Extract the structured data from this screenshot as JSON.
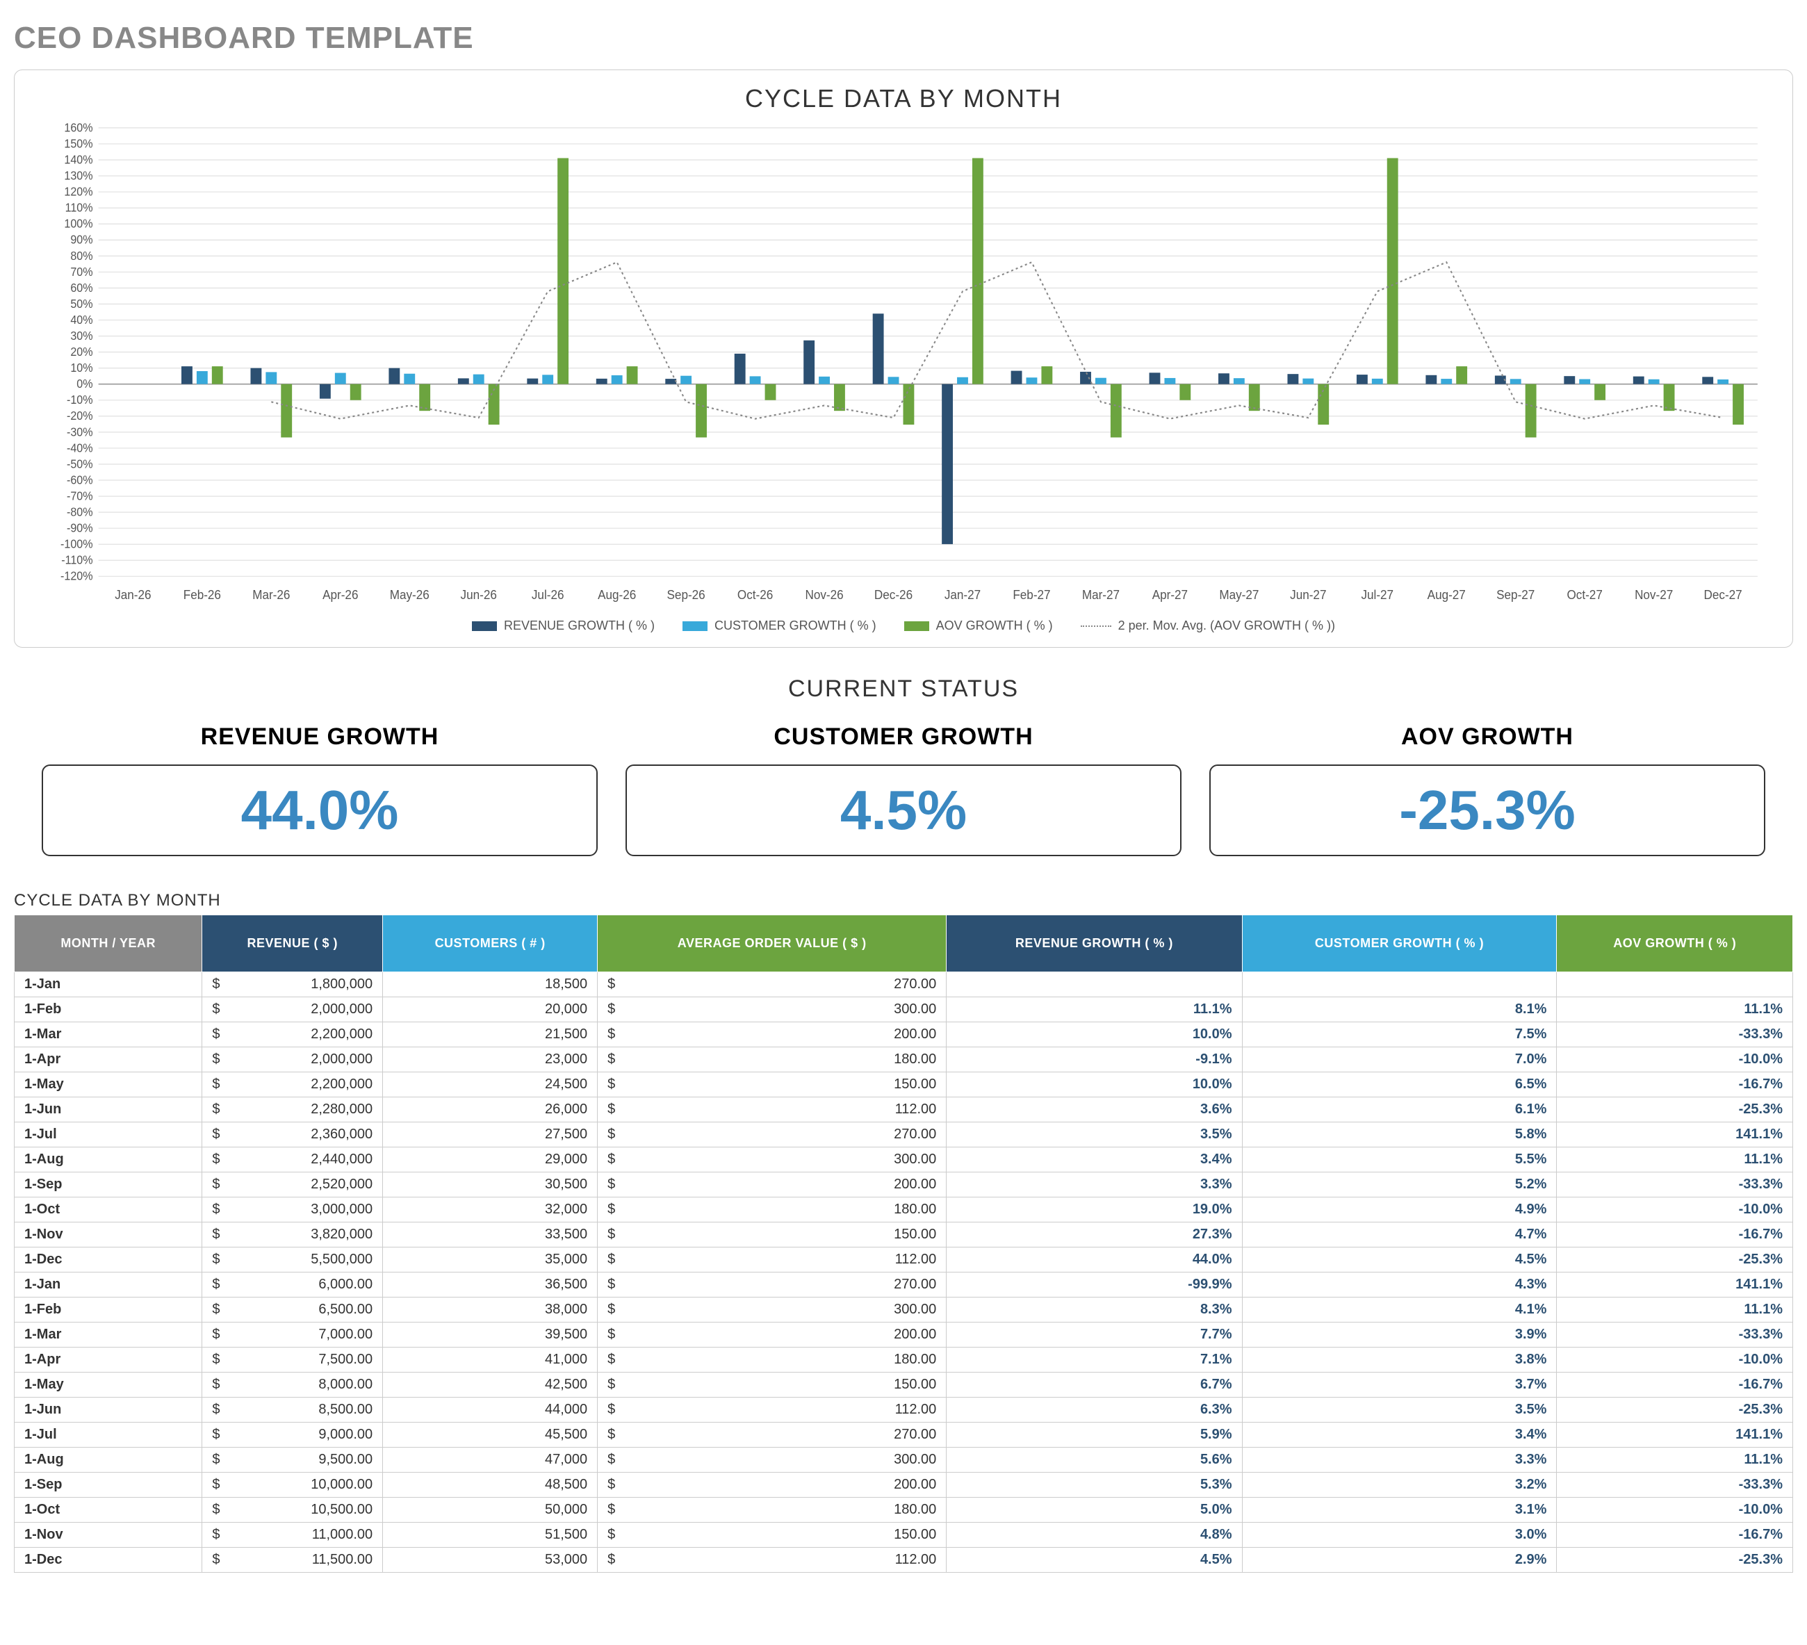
{
  "title": "CEO DASHBOARD TEMPLATE",
  "chart_title": "CYCLE DATA BY MONTH",
  "section_status": "CURRENT STATUS",
  "table_caption": "CYCLE DATA BY MONTH",
  "colors": {
    "revenue": "#2C5072",
    "customer": "#38A9DA",
    "aov": "#6CA43F",
    "mov_avg": "#888888"
  },
  "status": {
    "revenue": {
      "label": "REVENUE GROWTH",
      "value": "44.0%"
    },
    "customer": {
      "label": "CUSTOMER GROWTH",
      "value": "4.5%"
    },
    "aov": {
      "label": "AOV GROWTH",
      "value": "-25.3%"
    }
  },
  "legend": {
    "revenue": "REVENUE GROWTH  ( % )",
    "customer": "CUSTOMER GROWTH  ( % )",
    "aov": "AOV GROWTH  ( % )",
    "mov_avg": "2 per. Mov. Avg. (AOV GROWTH  ( % ))"
  },
  "table_headers": {
    "month": "MONTH / YEAR",
    "revenue": "REVENUE  ( $ )",
    "customers": "CUSTOMERS  ( # )",
    "aov": "AVERAGE ORDER VALUE  ( $ )",
    "rev_growth": "REVENUE GROWTH  ( % )",
    "cust_growth": "CUSTOMER GROWTH  ( % )",
    "aov_growth": "AOV GROWTH  ( % )"
  },
  "table_rows": [
    {
      "month": "1-Jan",
      "revenue": "1,800,000",
      "customers": "18,500",
      "aov": "270.00",
      "rev_g": "",
      "cust_g": "",
      "aov_g": ""
    },
    {
      "month": "1-Feb",
      "revenue": "2,000,000",
      "customers": "20,000",
      "aov": "300.00",
      "rev_g": "11.1%",
      "cust_g": "8.1%",
      "aov_g": "11.1%"
    },
    {
      "month": "1-Mar",
      "revenue": "2,200,000",
      "customers": "21,500",
      "aov": "200.00",
      "rev_g": "10.0%",
      "cust_g": "7.5%",
      "aov_g": "-33.3%"
    },
    {
      "month": "1-Apr",
      "revenue": "2,000,000",
      "customers": "23,000",
      "aov": "180.00",
      "rev_g": "-9.1%",
      "cust_g": "7.0%",
      "aov_g": "-10.0%"
    },
    {
      "month": "1-May",
      "revenue": "2,200,000",
      "customers": "24,500",
      "aov": "150.00",
      "rev_g": "10.0%",
      "cust_g": "6.5%",
      "aov_g": "-16.7%"
    },
    {
      "month": "1-Jun",
      "revenue": "2,280,000",
      "customers": "26,000",
      "aov": "112.00",
      "rev_g": "3.6%",
      "cust_g": "6.1%",
      "aov_g": "-25.3%"
    },
    {
      "month": "1-Jul",
      "revenue": "2,360,000",
      "customers": "27,500",
      "aov": "270.00",
      "rev_g": "3.5%",
      "cust_g": "5.8%",
      "aov_g": "141.1%"
    },
    {
      "month": "1-Aug",
      "revenue": "2,440,000",
      "customers": "29,000",
      "aov": "300.00",
      "rev_g": "3.4%",
      "cust_g": "5.5%",
      "aov_g": "11.1%"
    },
    {
      "month": "1-Sep",
      "revenue": "2,520,000",
      "customers": "30,500",
      "aov": "200.00",
      "rev_g": "3.3%",
      "cust_g": "5.2%",
      "aov_g": "-33.3%"
    },
    {
      "month": "1-Oct",
      "revenue": "3,000,000",
      "customers": "32,000",
      "aov": "180.00",
      "rev_g": "19.0%",
      "cust_g": "4.9%",
      "aov_g": "-10.0%"
    },
    {
      "month": "1-Nov",
      "revenue": "3,820,000",
      "customers": "33,500",
      "aov": "150.00",
      "rev_g": "27.3%",
      "cust_g": "4.7%",
      "aov_g": "-16.7%"
    },
    {
      "month": "1-Dec",
      "revenue": "5,500,000",
      "customers": "35,000",
      "aov": "112.00",
      "rev_g": "44.0%",
      "cust_g": "4.5%",
      "aov_g": "-25.3%"
    },
    {
      "month": "1-Jan",
      "revenue": "6,000.00",
      "customers": "36,500",
      "aov": "270.00",
      "rev_g": "-99.9%",
      "cust_g": "4.3%",
      "aov_g": "141.1%"
    },
    {
      "month": "1-Feb",
      "revenue": "6,500.00",
      "customers": "38,000",
      "aov": "300.00",
      "rev_g": "8.3%",
      "cust_g": "4.1%",
      "aov_g": "11.1%"
    },
    {
      "month": "1-Mar",
      "revenue": "7,000.00",
      "customers": "39,500",
      "aov": "200.00",
      "rev_g": "7.7%",
      "cust_g": "3.9%",
      "aov_g": "-33.3%"
    },
    {
      "month": "1-Apr",
      "revenue": "7,500.00",
      "customers": "41,000",
      "aov": "180.00",
      "rev_g": "7.1%",
      "cust_g": "3.8%",
      "aov_g": "-10.0%"
    },
    {
      "month": "1-May",
      "revenue": "8,000.00",
      "customers": "42,500",
      "aov": "150.00",
      "rev_g": "6.7%",
      "cust_g": "3.7%",
      "aov_g": "-16.7%"
    },
    {
      "month": "1-Jun",
      "revenue": "8,500.00",
      "customers": "44,000",
      "aov": "112.00",
      "rev_g": "6.3%",
      "cust_g": "3.5%",
      "aov_g": "-25.3%"
    },
    {
      "month": "1-Jul",
      "revenue": "9,000.00",
      "customers": "45,500",
      "aov": "270.00",
      "rev_g": "5.9%",
      "cust_g": "3.4%",
      "aov_g": "141.1%"
    },
    {
      "month": "1-Aug",
      "revenue": "9,500.00",
      "customers": "47,000",
      "aov": "300.00",
      "rev_g": "5.6%",
      "cust_g": "3.3%",
      "aov_g": "11.1%"
    },
    {
      "month": "1-Sep",
      "revenue": "10,000.00",
      "customers": "48,500",
      "aov": "200.00",
      "rev_g": "5.3%",
      "cust_g": "3.2%",
      "aov_g": "-33.3%"
    },
    {
      "month": "1-Oct",
      "revenue": "10,500.00",
      "customers": "50,000",
      "aov": "180.00",
      "rev_g": "5.0%",
      "cust_g": "3.1%",
      "aov_g": "-10.0%"
    },
    {
      "month": "1-Nov",
      "revenue": "11,000.00",
      "customers": "51,500",
      "aov": "150.00",
      "rev_g": "4.8%",
      "cust_g": "3.0%",
      "aov_g": "-16.7%"
    },
    {
      "month": "1-Dec",
      "revenue": "11,500.00",
      "customers": "53,000",
      "aov": "112.00",
      "rev_g": "4.5%",
      "cust_g": "2.9%",
      "aov_g": "-25.3%"
    }
  ],
  "chart_data": {
    "type": "bar",
    "title": "CYCLE DATA BY MONTH",
    "xlabel": "",
    "ylabel": "",
    "ylim": [
      -120,
      160
    ],
    "y_ticks": [
      -120,
      -110,
      -100,
      -90,
      -80,
      -70,
      -60,
      -50,
      -40,
      -30,
      -20,
      -10,
      0,
      10,
      20,
      30,
      40,
      50,
      60,
      70,
      80,
      90,
      100,
      110,
      120,
      130,
      140,
      150,
      160
    ],
    "categories": [
      "Jan-26",
      "Feb-26",
      "Mar-26",
      "Apr-26",
      "May-26",
      "Jun-26",
      "Jul-26",
      "Aug-26",
      "Sep-26",
      "Oct-26",
      "Nov-26",
      "Dec-26",
      "Jan-27",
      "Feb-27",
      "Mar-27",
      "Apr-27",
      "May-27",
      "Jun-27",
      "Jul-27",
      "Aug-27",
      "Sep-27",
      "Oct-27",
      "Nov-27",
      "Dec-27"
    ],
    "series": [
      {
        "name": "REVENUE GROWTH  ( % )",
        "color": "#2C5072",
        "type": "bar",
        "values": [
          null,
          11.1,
          10.0,
          -9.1,
          10.0,
          3.6,
          3.5,
          3.4,
          3.3,
          19.0,
          27.3,
          44.0,
          -99.9,
          8.3,
          7.7,
          7.1,
          6.7,
          6.3,
          5.9,
          5.6,
          5.3,
          5.0,
          4.8,
          4.5
        ]
      },
      {
        "name": "CUSTOMER GROWTH  ( % )",
        "color": "#38A9DA",
        "type": "bar",
        "values": [
          null,
          8.1,
          7.5,
          7.0,
          6.5,
          6.1,
          5.8,
          5.5,
          5.2,
          4.9,
          4.7,
          4.5,
          4.3,
          4.1,
          3.9,
          3.8,
          3.7,
          3.5,
          3.4,
          3.3,
          3.2,
          3.1,
          3.0,
          2.9
        ]
      },
      {
        "name": "AOV GROWTH  ( % )",
        "color": "#6CA43F",
        "type": "bar",
        "values": [
          null,
          11.1,
          -33.3,
          -10.0,
          -16.7,
          -25.3,
          141.1,
          11.1,
          -33.3,
          -10.0,
          -16.7,
          -25.3,
          141.1,
          11.1,
          -33.3,
          -10.0,
          -16.7,
          -25.3,
          141.1,
          11.1,
          -33.3,
          -10.0,
          -16.7,
          -25.3
        ]
      },
      {
        "name": "2 per. Mov. Avg. (AOV GROWTH  ( % ))",
        "color": "#888888",
        "type": "line_dotted",
        "values": [
          null,
          null,
          -11.1,
          -21.65,
          -13.35,
          -21.0,
          57.9,
          76.1,
          -11.1,
          -21.65,
          -13.35,
          -21.0,
          57.9,
          76.1,
          -11.1,
          -21.65,
          -13.35,
          -21.0,
          57.9,
          76.1,
          -11.1,
          -21.65,
          -13.35,
          -21.0
        ]
      }
    ]
  }
}
